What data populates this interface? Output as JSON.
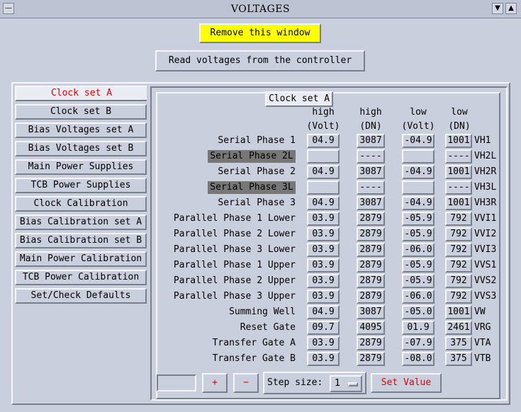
{
  "window": {
    "title": "VOLTAGES"
  },
  "top_buttons": {
    "remove": "Remove this window",
    "read": "Read voltages from the controller"
  },
  "tabs": [
    "Clock set A",
    "Clock set B",
    "Bias Voltages set A",
    "Bias Voltages set B",
    "Main Power Supplies",
    "TCB Power Supplies",
    "Clock Calibration",
    "Bias Calibration set A",
    "Bias Calibration set B",
    "Main Power Calibration",
    "TCB Power Calibration",
    "Set/Check Defaults"
  ],
  "panel": {
    "title": "Clock set A",
    "headers": {
      "high_volt_1": "high",
      "high_volt_2": "(Volt)",
      "high_dn_1": "high",
      "high_dn_2": "(DN)",
      "low_volt_1": "low",
      "low_volt_2": "(Volt)",
      "low_dn_1": "low",
      "low_dn_2": "(DN)"
    },
    "rows": [
      {
        "label": "Serial Phase 1",
        "hv": "04.9",
        "hdn": "3087",
        "lv": "-04.9",
        "ldn": "1001",
        "code": "VH1"
      },
      {
        "label": "Serial Phase 2L",
        "hv": "",
        "hdn": "----",
        "lv": "",
        "ldn": "----",
        "code": "VH2L"
      },
      {
        "label": "Serial Phase 2",
        "hv": "04.9",
        "hdn": "3087",
        "lv": "-04.9",
        "ldn": "1001",
        "code": "VH2R"
      },
      {
        "label": "Serial Phase 3L",
        "hv": "",
        "hdn": "----",
        "lv": "",
        "ldn": "----",
        "code": "VH3L"
      },
      {
        "label": "Serial Phase 3",
        "hv": "04.9",
        "hdn": "3087",
        "lv": "-04.9",
        "ldn": "1001",
        "code": "VH3R"
      },
      {
        "label": "Parallel Phase 1 Lower",
        "hv": "03.9",
        "hdn": "2879",
        "lv": "-05.9",
        "ldn": "792",
        "code": "VVI1"
      },
      {
        "label": "Parallel Phase 2 Lower",
        "hv": "03.9",
        "hdn": "2879",
        "lv": "-05.9",
        "ldn": "792",
        "code": "VVI2"
      },
      {
        "label": "Parallel Phase 3 Lower",
        "hv": "03.9",
        "hdn": "2879",
        "lv": "-06.0",
        "ldn": "792",
        "code": "VVI3"
      },
      {
        "label": "Parallel Phase 1 Upper",
        "hv": "03.9",
        "hdn": "2879",
        "lv": "-05.9",
        "ldn": "792",
        "code": "VVS1"
      },
      {
        "label": "Parallel Phase 2 Upper",
        "hv": "03.9",
        "hdn": "2879",
        "lv": "-05.9",
        "ldn": "792",
        "code": "VVS2"
      },
      {
        "label": "Parallel Phase 3 Upper",
        "hv": "03.9",
        "hdn": "2879",
        "lv": "-06.0",
        "ldn": "792",
        "code": "VVS3"
      },
      {
        "label": "Summing Well",
        "hv": "04.9",
        "hdn": "3087",
        "lv": "-05.0",
        "ldn": "1001",
        "code": "VW"
      },
      {
        "label": "Reset Gate",
        "hv": "09.7",
        "hdn": "4095",
        "lv": "01.9",
        "ldn": "2461",
        "code": "VRG"
      },
      {
        "label": "Transfer Gate A",
        "hv": "03.9",
        "hdn": "2879",
        "lv": "-07.9",
        "ldn": "375",
        "code": "VTA"
      },
      {
        "label": "Transfer Gate B",
        "hv": "03.9",
        "hdn": "2879",
        "lv": "-08.0",
        "ldn": "375",
        "code": "VTB"
      }
    ],
    "controls": {
      "value_input": "",
      "plus": "+",
      "minus": "−",
      "step_label": "Step size:",
      "step_value": "1",
      "set_value": "Set Value"
    }
  }
}
